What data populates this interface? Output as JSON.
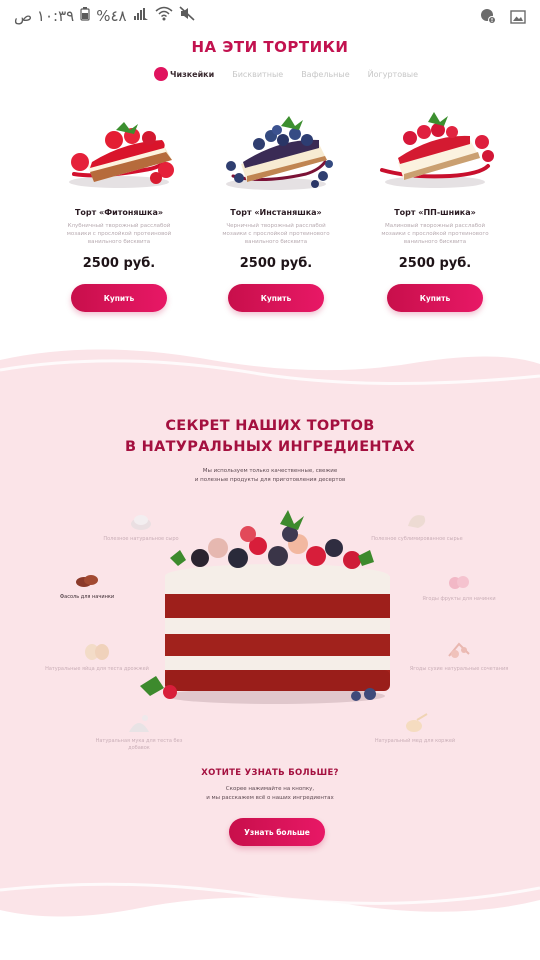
{
  "status_bar": {
    "time": "١٠:٣٩ ص",
    "battery": "%٤٨",
    "icons": [
      "signal-icon",
      "wifi-icon",
      "mute-icon",
      "notification-icon",
      "gallery-icon"
    ]
  },
  "colors": {
    "accent": "#e0135e",
    "title": "#c2124f",
    "pink_bg": "#fbe4e8"
  },
  "products": {
    "title": "НА ЭТИ ТОРТИКИ",
    "tabs": [
      {
        "label": "Чизкейки",
        "active": true
      },
      {
        "label": "Бисквитные",
        "active": false
      },
      {
        "label": "Вафельные",
        "active": false
      },
      {
        "label": "Йогуртовые",
        "active": false
      }
    ],
    "cards": [
      {
        "name": "Торт «Фитоняшка»",
        "desc": "Клубничный творожный расслабой мозаики с прослойкой протеиновой ванильного бисквита",
        "price": "2500 руб.",
        "button": "Купить"
      },
      {
        "name": "Торт «Инстаняшка»",
        "desc": "Черничный творожный расслабой мозаики с прослойкой протеинового ванильного бисквита",
        "price": "2500 руб.",
        "button": "Купить"
      },
      {
        "name": "Торт «ПП-шника»",
        "desc": "Малиновый творожный расслабой мозаики с прослойкой протеинового ванильного бисквита",
        "price": "2500 руб.",
        "button": "Купить"
      }
    ]
  },
  "secret": {
    "title_line1": "СЕКРЕТ НАШИХ ТОРТОВ",
    "title_line2": "В НАТУРАЛЬНЫХ ИНГРЕДИЕНТАХ",
    "subtitle_line1": "Мы используем только качественные, свежие",
    "subtitle_line2": "и полезные продукты для приготовления десертов",
    "features": [
      {
        "text": "Полезное натуральное сыро"
      },
      {
        "text": "Фасоль для начинки"
      },
      {
        "text": "Натуральные яйца для теста дрожжей"
      },
      {
        "text": "Натуральная мука для теста без добавок"
      },
      {
        "text": "Полезное сублимированное сырье"
      },
      {
        "text": "Ягоды фрукты для начинки"
      },
      {
        "text": "Ягоды сухие натуральные сочетания"
      },
      {
        "text": "Натуральный мед для коржей"
      }
    ],
    "more_title": "ХОТИТЕ УЗНАТЬ БОЛЬШЕ?",
    "more_sub_line1": "Скорее нажимайте на кнопку,",
    "more_sub_line2": "и мы расскажем всё о наших ингредиентах",
    "more_button": "Узнать больше"
  }
}
